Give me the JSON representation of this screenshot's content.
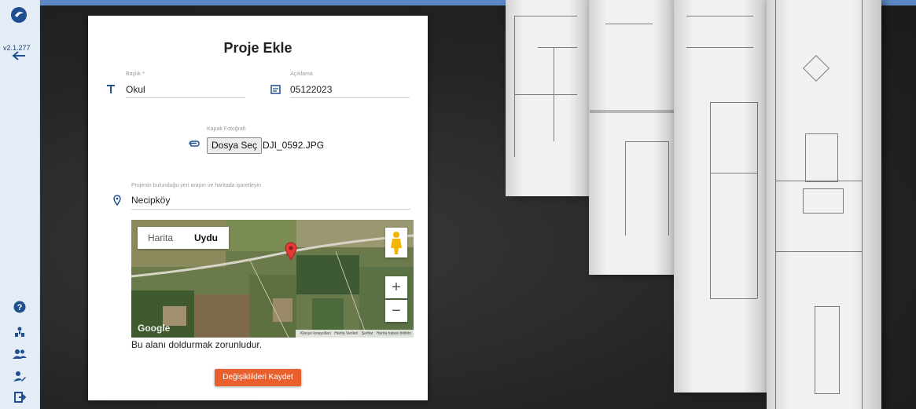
{
  "sidebar": {
    "version": "v2.1.277",
    "icons": [
      "logo-icon",
      "back-arrow-icon",
      "help-icon",
      "org-chart-icon",
      "users-icon",
      "user-edit-icon",
      "logout-icon"
    ]
  },
  "form": {
    "title": "Proje Ekle",
    "baslik_label": "Başlık *",
    "baslik_value": "Okul",
    "aciklama_label": "Açıklama",
    "aciklama_value": "05122023",
    "cover_label": "Kapak Fotoğrafı",
    "file_button": "Dosya Seç",
    "file_name": "DJI_0592.JPG",
    "location_label": "Projenin bulunduğu yeri arayın ve haritada işaretleyin",
    "location_value": "Necipköy",
    "required_message": "Bu alanı doldurmak zorunludur.",
    "save_button": "Değişiklikleri Kaydet"
  },
  "map": {
    "tab_map": "Harita",
    "tab_satellite": "Uydu",
    "active_tab": "Uydu",
    "zoom_in": "+",
    "zoom_out": "−",
    "logo": "Google",
    "attribution": [
      "Klavye kısayolları",
      "Harita Verileri",
      "Şartlar",
      "Harita hatası bildirin"
    ]
  },
  "colors": {
    "sidebar_bg": "#e4ecf5",
    "accent_blue": "#1d4f91",
    "save_orange": "#e9602e",
    "pin_red": "#e53935"
  }
}
